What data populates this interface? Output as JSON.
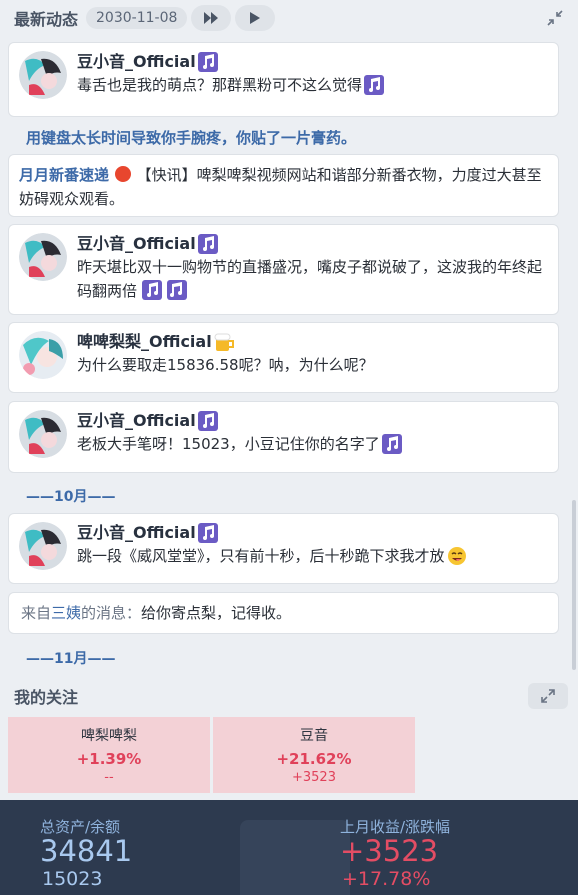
{
  "header": {
    "title": "最新动态",
    "date": "2030-11-08"
  },
  "feed": {
    "items": [
      {
        "name": "豆小音_Official",
        "text": "毒舌也是我的萌点？那群黑粉可不这么觉得"
      },
      {
        "system": "用键盘太长时间导致你手腕疼，你贴了一片膏药。"
      },
      {
        "source": "月月新番速递",
        "text": "【快讯】啤梨啤梨视频网站和谐部分新番衣物，力度过大甚至妨碍观众观看。"
      },
      {
        "name": "豆小音_Official",
        "text": "昨天堪比双十一购物节的直播盛况，嘴皮子都说破了，这波我的年终起码翻两倍"
      },
      {
        "name": "啤啤梨梨_Official",
        "text": "为什么要取走15836.58呢？呐，为什么呢？"
      },
      {
        "name": "豆小音_Official",
        "text": "老板大手笔呀！15023，小豆记住你的名字了"
      },
      {
        "month": "——10月——"
      },
      {
        "name": "豆小音_Official",
        "text": "跳一段《威风堂堂》，只有前十秒，后十秒跪下求我才放"
      },
      {
        "note_prefix": "来自",
        "note_from": "三姨",
        "note_mid": "的消息：",
        "note_text": "给你寄点梨，记得收。"
      },
      {
        "month": "——11月——"
      }
    ]
  },
  "follow": {
    "title": "我的关注",
    "tiles": [
      {
        "name": "啤梨啤梨",
        "change": "+1.39%",
        "sub": "--"
      },
      {
        "name": "豆音",
        "change": "+21.62%",
        "sub": "+3523"
      }
    ]
  },
  "summary": {
    "assets_label": "总资产/余额",
    "assets_value": "34841",
    "balance_value": "15023",
    "income_label": "上月收益/涨跌幅",
    "income_value": "+3523",
    "income_pct": "+17.78%"
  },
  "colors": {
    "accent_blue": "#3d6aa8",
    "up_red": "#e44d64",
    "tile_bg": "#f3d1d6"
  },
  "icons": [
    "fast-forward-icon",
    "play-icon",
    "collapse-icon",
    "expand-icon",
    "music-note-icon",
    "beer-icon",
    "grin-emoji-icon",
    "red-circle-icon"
  ]
}
